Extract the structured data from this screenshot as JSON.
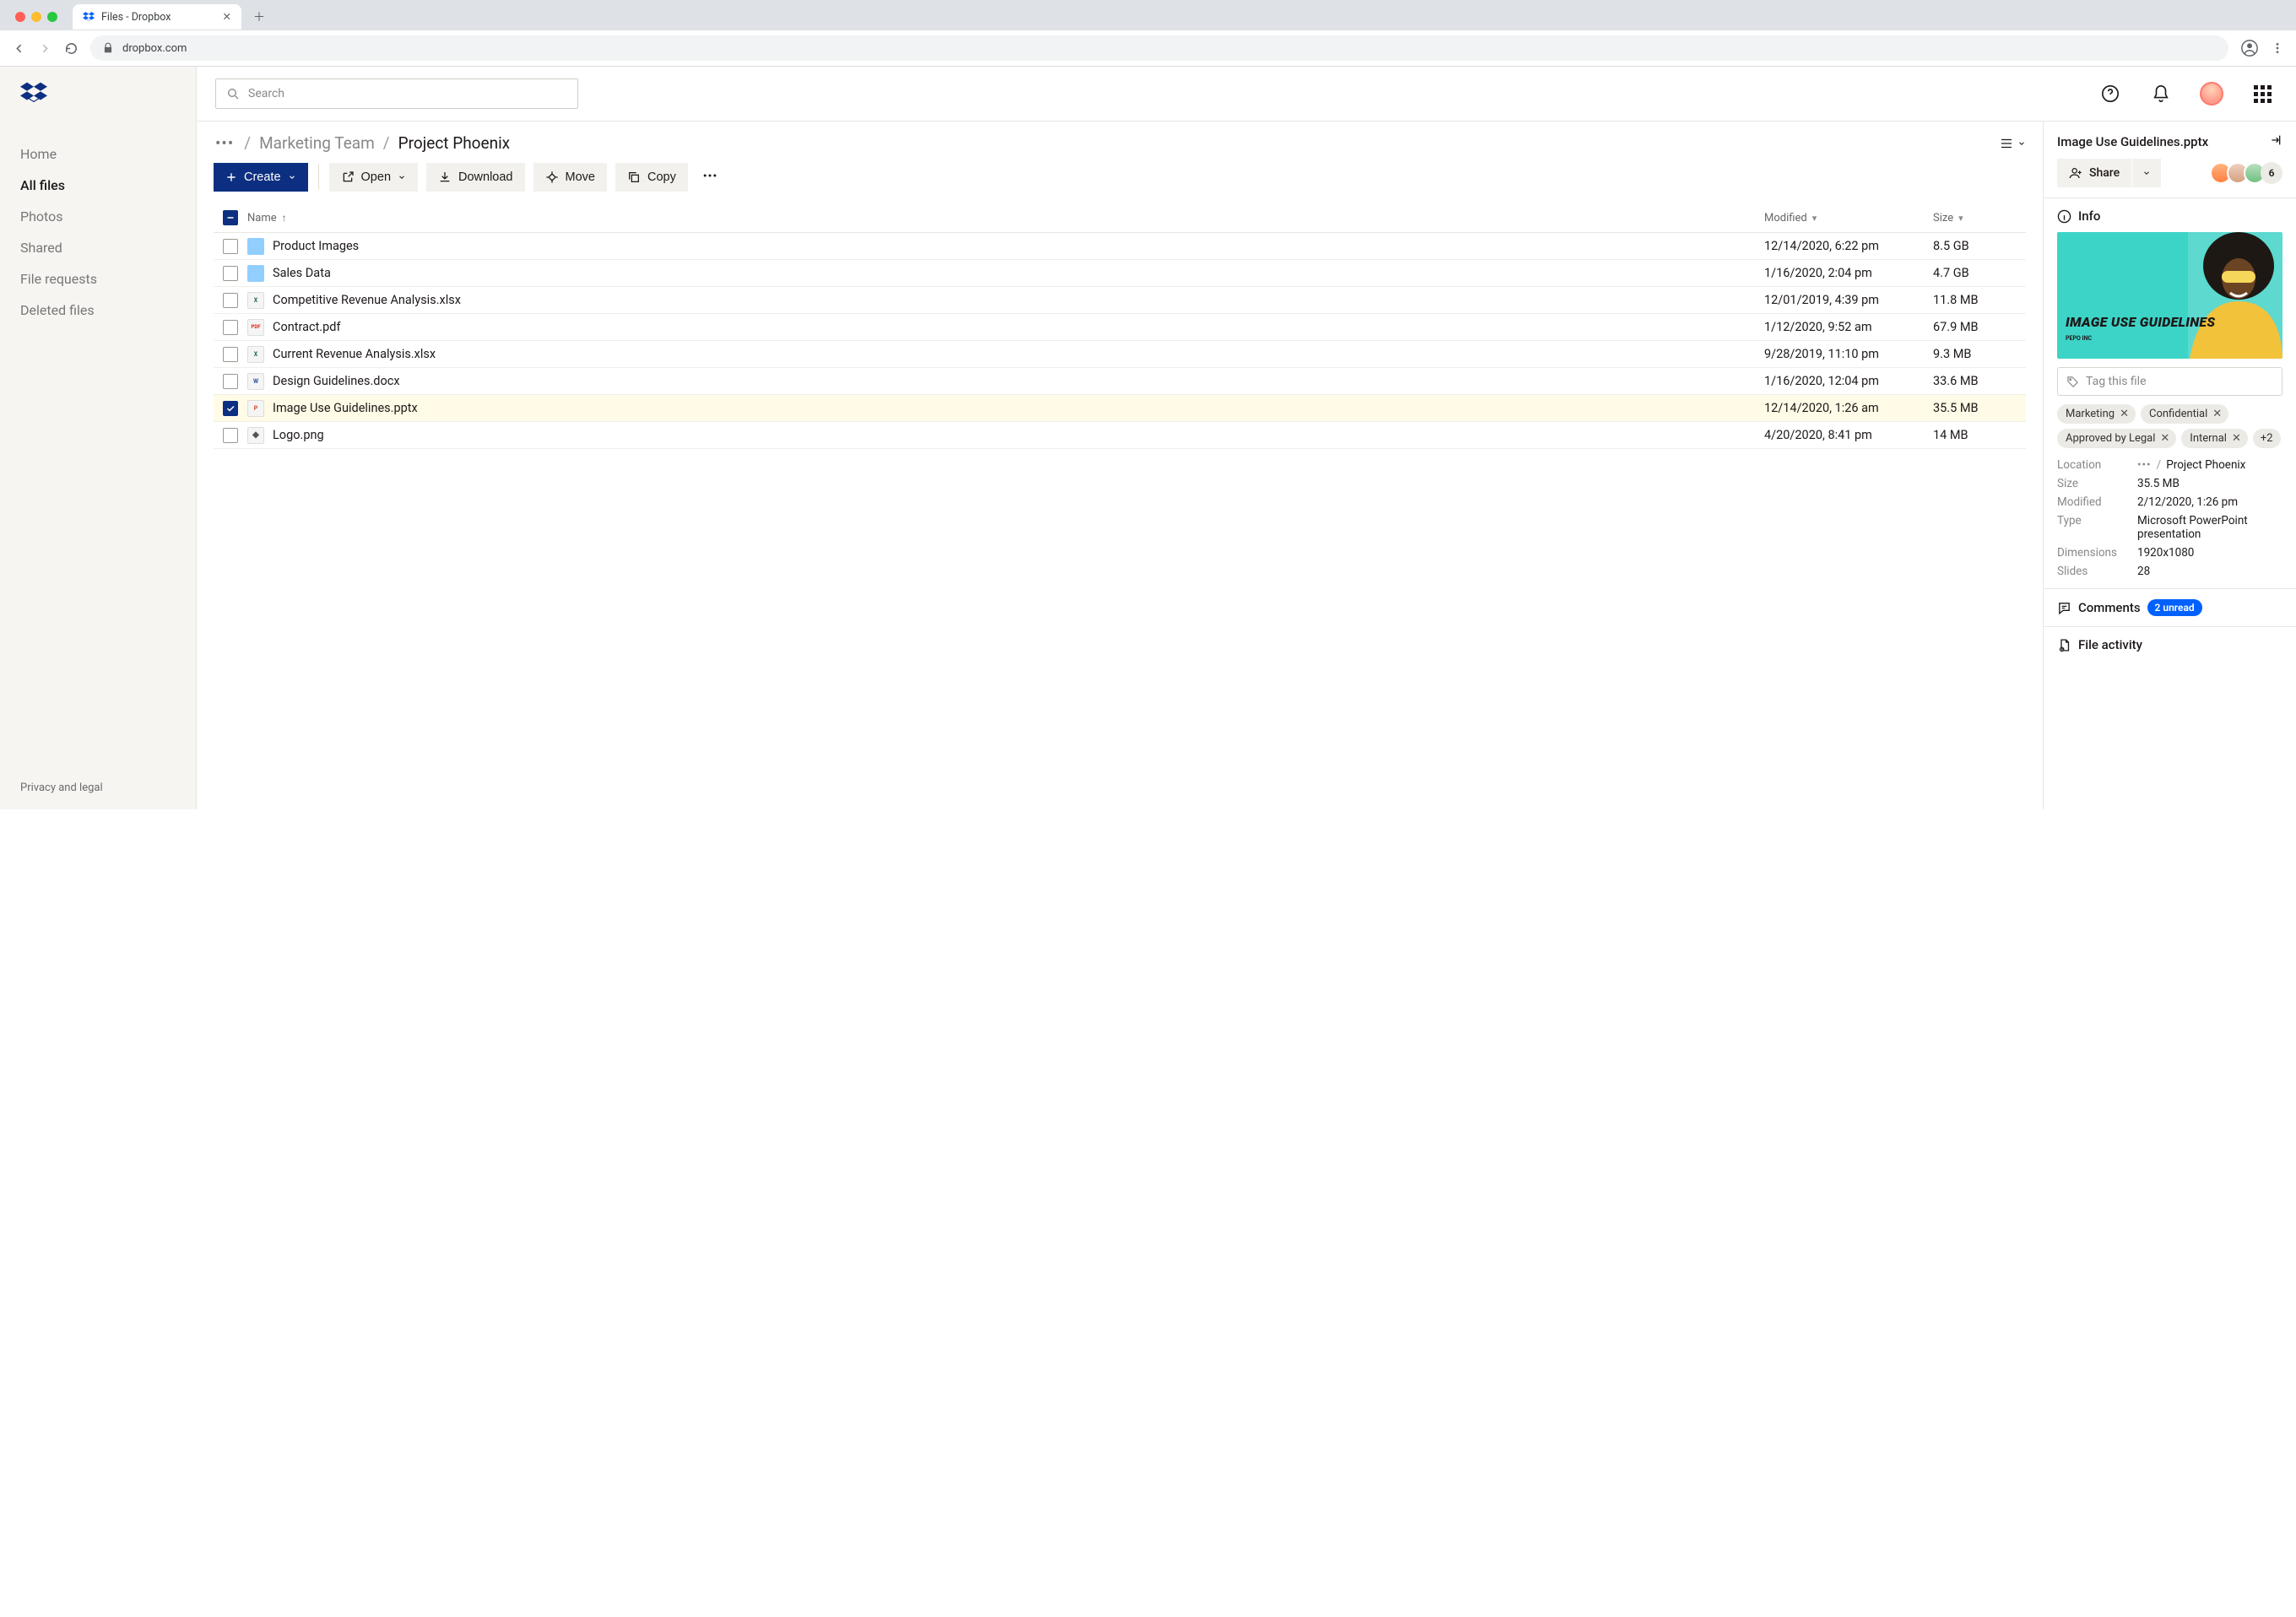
{
  "browser": {
    "tab_title": "Files - Dropbox",
    "url": "dropbox.com"
  },
  "sidebar": {
    "items": [
      {
        "label": "Home",
        "active": false
      },
      {
        "label": "All files",
        "active": true
      },
      {
        "label": "Photos",
        "active": false
      },
      {
        "label": "Shared",
        "active": false
      },
      {
        "label": "File requests",
        "active": false
      },
      {
        "label": "Deleted files",
        "active": false
      }
    ],
    "footer": "Privacy and legal"
  },
  "search": {
    "placeholder": "Search"
  },
  "breadcrumb": {
    "parent": "Marketing Team",
    "current": "Project Phoenix"
  },
  "actions": {
    "create": "Create",
    "open": "Open",
    "download": "Download",
    "move": "Move",
    "copy": "Copy"
  },
  "table": {
    "headers": {
      "name": "Name",
      "modified": "Modified",
      "size": "Size"
    },
    "rows": [
      {
        "type": "folder",
        "name": "Product Images",
        "modified": "12/14/2020, 6:22 pm",
        "size": "8.5 GB",
        "selected": false
      },
      {
        "type": "folder",
        "name": "Sales Data",
        "modified": "1/16/2020, 2:04 pm",
        "size": "4.7 GB",
        "selected": false
      },
      {
        "type": "xlsx",
        "name": "Competitive Revenue Analysis.xlsx",
        "modified": "12/01/2019, 4:39 pm",
        "size": "11.8 MB",
        "selected": false
      },
      {
        "type": "pdf",
        "name": "Contract.pdf",
        "modified": "1/12/2020, 9:52 am",
        "size": "67.9 MB",
        "selected": false
      },
      {
        "type": "xlsx",
        "name": "Current Revenue Analysis.xlsx",
        "modified": "9/28/2019, 11:10 pm",
        "size": "9.3 MB",
        "selected": false
      },
      {
        "type": "docx",
        "name": "Design Guidelines.docx",
        "modified": "1/16/2020, 12:04 pm",
        "size": "33.6 MB",
        "selected": false
      },
      {
        "type": "pptx",
        "name": "Image Use Guidelines.pptx",
        "modified": "12/14/2020, 1:26 am",
        "size": "35.5 MB",
        "selected": true
      },
      {
        "type": "png",
        "name": "Logo.png",
        "modified": "4/20/2020, 8:41 pm",
        "size": "14 MB",
        "selected": false
      }
    ]
  },
  "details": {
    "title": "Image Use Guidelines.pptx",
    "share_label": "Share",
    "collaborator_count": "6",
    "info_label": "Info",
    "preview": {
      "headline": "IMAGE USE GUIDELINES",
      "sub": "PEPO INC"
    },
    "tag_placeholder": "Tag this file",
    "tags": [
      "Marketing",
      "Confidential",
      "Approved by Legal",
      "Internal"
    ],
    "tags_more": "+2",
    "meta": {
      "location_label": "Location",
      "location_value": "Project Phoenix",
      "size_label": "Size",
      "size_value": "35.5 MB",
      "modified_label": "Modified",
      "modified_value": "2/12/2020, 1:26 pm",
      "type_label": "Type",
      "type_value": "Microsoft PowerPoint presentation",
      "dimensions_label": "Dimensions",
      "dimensions_value": "1920x1080",
      "slides_label": "Slides",
      "slides_value": "28"
    },
    "comments_label": "Comments",
    "comments_unread": "2 unread",
    "activity_label": "File activity"
  }
}
